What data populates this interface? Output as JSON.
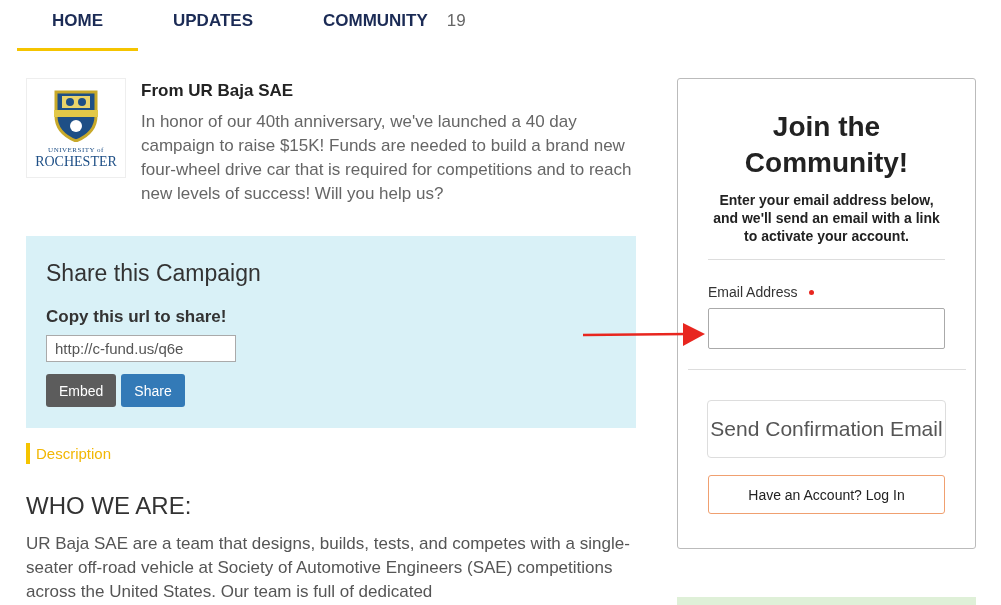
{
  "tabs": [
    {
      "label": "HOME",
      "selected": true
    },
    {
      "label": "UPDATES",
      "selected": false
    },
    {
      "label": "COMMUNITY",
      "count": "19",
      "selected": false
    }
  ],
  "intro": {
    "logo_lines": [
      "UNIVERSITY of",
      "ROCHESTER"
    ],
    "title": "From UR Baja SAE",
    "text": "In honor of our 40th anniversary, we've launched a 40 day campaign to raise $15K! Funds are needed to build a brand new four-wheel drive car that is required for competitions and to reach new levels of success! Will you help us?"
  },
  "share": {
    "title": "Share this Campaign",
    "label": "Copy this url to share!",
    "url": "http://c-fund.us/q6e",
    "buttons": [
      {
        "label": "Embed",
        "kind": "secondary"
      },
      {
        "label": "Share",
        "kind": "primary"
      }
    ]
  },
  "section_label": "Description",
  "heading": "WHO WE ARE:",
  "paragraph": "UR Baja SAE are a team that designs, builds, tests, and competes with a single-seater off-road vehicle at Society of Automotive Engineers (SAE) competitions across the United States. Our team is full of dedicated",
  "join": {
    "title": "Join the Community!",
    "subtitle": "Enter your email address below, and we'll send an email with a link to activate your account.",
    "field_label": "Email Address",
    "required": true,
    "send_button": "Send Confirmation Email",
    "login_button": "Have an Account? Log In"
  }
}
